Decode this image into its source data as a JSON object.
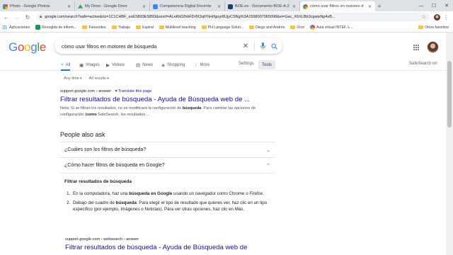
{
  "browser": {
    "tabs": [
      {
        "label": "Photo - Google Photos",
        "color": "#fbbc05",
        "active": false
      },
      {
        "label": "My Drive - Google Drive",
        "color": "#34a853",
        "active": false
      },
      {
        "label": "Competencia Digital Docente",
        "color": "#4285f4",
        "active": false
      },
      {
        "label": "BOE.es - Documento BOE-A-2",
        "color": "#1a3e72",
        "active": false
      },
      {
        "label": "cómo usar filtros en motores d",
        "color": "#4285f4",
        "active": true
      }
    ],
    "new_tab": "+",
    "url": "google.com/search?safe=active&rlz=1C1CHBF_esES893ES893&sxsrf=ALeKk02hbFDrfX3qtYhHrfguyr8UjyCSNg%3A1598007065098&ei=Gac_X6XLBb3cgwwNp4vB...",
    "bookmarks": [
      {
        "label": "Aplicaciones",
        "icon": "apps-grid-icon"
      },
      {
        "label": "Recogida de inform...",
        "icon": "classroom-icon"
      },
      {
        "label": "Favourites",
        "icon": "folder-icon"
      },
      {
        "label": "Trabajo",
        "icon": "folder-icon"
      },
      {
        "label": "Espiral",
        "icon": "folder-icon"
      },
      {
        "label": "Multilevel teaching",
        "icon": "folder-icon"
      },
      {
        "label": "PH Language Soluti...",
        "icon": "folder-icon"
      },
      {
        "label": "Diego and Andrés",
        "icon": "folder-icon"
      },
      {
        "label": "Ocio",
        "icon": "folder-icon"
      },
      {
        "label": "Aula virtual INTEF. L...",
        "icon": "intef-icon"
      }
    ],
    "other_bookmarks": "Otros favoritos"
  },
  "search": {
    "logo": [
      "G",
      "o",
      "o",
      "g",
      "l",
      "e"
    ],
    "query": "cómo usar filtros en motores de búsqueda"
  },
  "gtabs": {
    "all": "All",
    "images": "Images",
    "videos": "Videos",
    "news": "News",
    "shopping": "Shopping",
    "more": "More",
    "settings": "Settings",
    "tools": "Tools",
    "safesearch": "SafeSearch on"
  },
  "filters": {
    "time": "Any time",
    "results": "All results"
  },
  "result1": {
    "cite": "support.google.com › answer",
    "translate": "Translate this page",
    "title": "Filtrar resultados de búsqueda - Ayuda de Búsqueda web de ...",
    "snippet_pre": "Nota: Si se filtran los resultados, no se modificará la configuración de ",
    "snippet_b1": "búsqueda",
    "snippet_mid": ". Para cambiar las opciones de configuración (",
    "snippet_b2": "como",
    "snippet_post": " SafeSearch, los resultados ..."
  },
  "paa": {
    "title": "People also ask",
    "q1": "¿Cuáles son los filtros de búsqueda?",
    "q2": "¿Cómo hacer filtros de búsqueda en Google?",
    "answer_heading": "Filtrar resultados de búsqueda",
    "step1_pre": "En la computadora, haz una ",
    "step1_b": "búsqueda en Google",
    "step1_post": " usando un navegador como Chrome o Firefox.",
    "step2_pre": "Debajo del cuadro de ",
    "step2_b": "búsqueda",
    "step2_post": ": Para elegir el tipo de resultado que quieres ver, haz clic en un tipo específico (por ejemplo, Imágenes o Noticias). Para ver otras opciones, haz clic en Más.",
    "source_cite": "support.google.com › websearch › answer",
    "source_title": "Filtrar resultados de búsqueda - Ayuda de Búsqueda web de"
  }
}
